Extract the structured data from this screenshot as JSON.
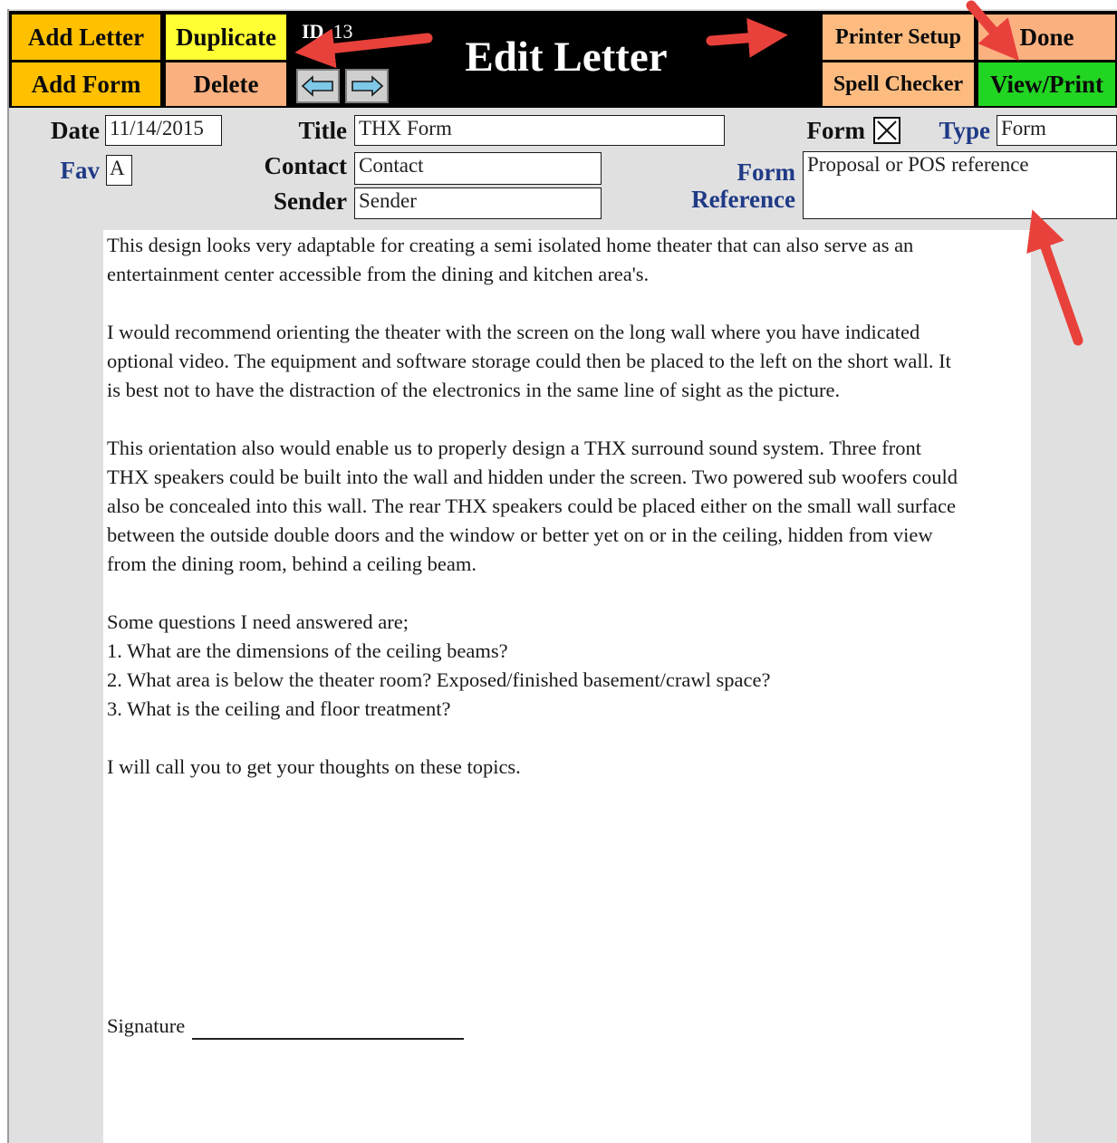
{
  "toolbar": {
    "add_letter": "Add Letter",
    "duplicate": "Duplicate",
    "add_form": "Add Form",
    "delete": "Delete",
    "id_label": "ID",
    "id_value": "13",
    "window_title": "Edit Letter",
    "printer_setup": "Printer Setup",
    "done": "Done",
    "spell_checker": "Spell Checker",
    "view_print": "View/Print"
  },
  "form": {
    "date_label": "Date",
    "date_value": "11/14/2015",
    "title_label": "Title",
    "title_value": "THX Form",
    "form_label": "Form",
    "form_checked": true,
    "type_label": "Type",
    "type_value": "Form",
    "fav_label": "Fav",
    "fav_value": "A",
    "contact_label": "Contact",
    "contact_value": "Contact",
    "sender_label": "Sender",
    "sender_value": "Sender",
    "form_ref_label_1": "Form",
    "form_ref_label_2": "Reference",
    "form_ref_value": "Proposal or POS reference"
  },
  "letter": {
    "p1_l1": "This design looks very adaptable for creating a semi isolated home theater that can also serve as an",
    "p1_l2": "entertainment center accessible from the dining and kitchen area's.",
    "p2_l1": "I would recommend orienting the theater with the screen on the long wall where you have indicated",
    "p2_l2": "optional video.  The equipment and software storage could then be placed to the left on the short wall.  It",
    "p2_l3": "is best not to have the distraction of the electronics in the same line of sight as the picture.",
    "p3_l1": "This orientation also would enable us to properly design a THX surround sound system.  Three front",
    "p3_l2": "THX speakers could be built into the wall and hidden under the screen.   Two powered sub woofers could",
    "p3_l3": "also be concealed into this wall. The rear THX speakers could be placed either on the small wall surface",
    "p3_l4": "between the outside double doors and the window or better yet on or in the ceiling, hidden from view",
    "p3_l5": "from the dining room, behind a ceiling beam.",
    "q_intro": "Some questions I need answered are;",
    "q1": "1.  What are the dimensions of the ceiling beams?",
    "q2": "2.  What area is below the theater room?  Exposed/finished basement/crawl space?",
    "q3": "3.  What is the ceiling and floor treatment?",
    "closing": "I will call you to get your thoughts on these topics.",
    "signature_label": "Signature"
  },
  "colors": {
    "toolbar_bg": "#000000",
    "yellow_button": "#ffc000",
    "duplicate_button": "#ffff33",
    "orange_button": "#fbb080",
    "green_button": "#22d522",
    "blue_label": "#1f3a86",
    "annotation_arrow": "#e8413b"
  },
  "icons": {
    "nav_prev": "left-arrow-icon",
    "nav_next": "right-arrow-icon",
    "form_checkbox": "checked-x-icon"
  }
}
